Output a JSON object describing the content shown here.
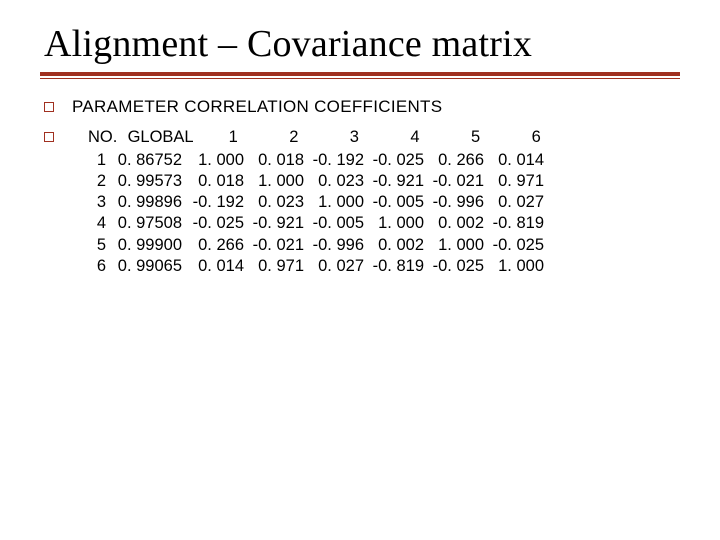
{
  "title": "Alignment – Covariance matrix",
  "subtitle": "PARAMETER  CORRELATION COEFFICIENTS",
  "headers": {
    "no": "NO.",
    "global": "GLOBAL",
    "cols": [
      "1",
      "2",
      "3",
      "4",
      "5",
      "6"
    ]
  },
  "rows": [
    {
      "no": "1",
      "global": "0. 86752",
      "c1": "1. 000",
      "c2": "0. 018",
      "c3": "-0. 192",
      "c4": "-0. 025",
      "c5": "0. 266",
      "c6": "0. 014"
    },
    {
      "no": "2",
      "global": "0. 99573",
      "c1": "0. 018",
      "c2": "1. 000",
      "c3": "0. 023",
      "c4": "-0. 921",
      "c5": "-0. 021",
      "c6": "0. 971"
    },
    {
      "no": "3",
      "global": "0. 99896",
      "c1": "-0. 192",
      "c2": "0. 023",
      "c3": "1. 000",
      "c4": "-0. 005",
      "c5": "-0. 996",
      "c6": "0. 027"
    },
    {
      "no": "4",
      "global": "0. 97508",
      "c1": "-0. 025",
      "c2": "-0. 921",
      "c3": "-0. 005",
      "c4": "1. 000",
      "c5": "0. 002",
      "c6": "-0. 819"
    },
    {
      "no": "5",
      "global": "0. 99900",
      "c1": "0. 266",
      "c2": "-0. 021",
      "c3": "-0. 996",
      "c4": "0. 002",
      "c5": "1. 000",
      "c6": "-0. 025"
    },
    {
      "no": "6",
      "global": "0. 99065",
      "c1": "0. 014",
      "c2": "0. 971",
      "c3": "0. 027",
      "c4": "-0. 819",
      "c5": "-0. 025",
      "c6": "1. 000"
    }
  ],
  "chart_data": {
    "type": "table",
    "title": "PARAMETER CORRELATION COEFFICIENTS",
    "columns": [
      "NO.",
      "GLOBAL",
      "1",
      "2",
      "3",
      "4",
      "5",
      "6"
    ],
    "data": [
      [
        1,
        0.86752,
        1.0,
        0.018,
        -0.192,
        -0.025,
        0.266,
        0.014
      ],
      [
        2,
        0.99573,
        0.018,
        1.0,
        0.023,
        -0.921,
        -0.021,
        0.971
      ],
      [
        3,
        0.99896,
        -0.192,
        0.023,
        1.0,
        -0.005,
        -0.996,
        0.027
      ],
      [
        4,
        0.97508,
        -0.025,
        -0.921,
        -0.005,
        1.0,
        0.002,
        -0.819
      ],
      [
        5,
        0.999,
        0.266,
        -0.021,
        -0.996,
        0.002,
        1.0,
        -0.025
      ],
      [
        6,
        0.99065,
        0.014,
        0.971,
        0.027,
        -0.819,
        -0.025,
        1.0
      ]
    ]
  }
}
